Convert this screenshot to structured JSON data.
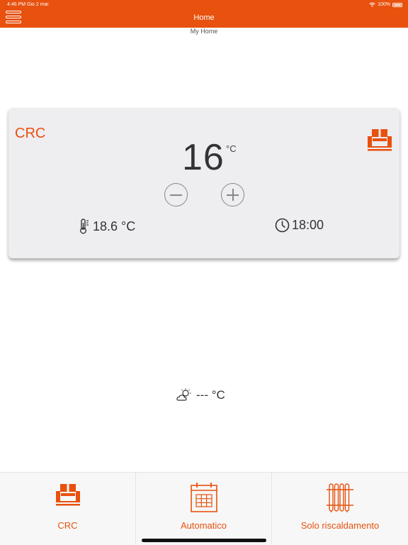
{
  "status_bar": {
    "time": "4:46 PM  Gio 2 mar",
    "battery": "100%"
  },
  "header": {
    "title": "Home",
    "subtitle": "My Home"
  },
  "zone_card": {
    "name": "CRC",
    "setpoint": "16",
    "setpoint_unit": "°C",
    "room_temperature": "18.6 °C",
    "timer": "18:00",
    "mode_icon": "sofa-icon"
  },
  "weather": {
    "icon": "partly-cloudy-icon",
    "value": "--- °C"
  },
  "bottom_tabs": [
    {
      "label": "CRC",
      "icon": "sofa-icon"
    },
    {
      "label": "Automatico",
      "icon": "calendar-icon"
    },
    {
      "label": "Solo riscaldamento",
      "icon": "radiator-icon"
    }
  ],
  "colors": {
    "accent": "#e8510e",
    "card_background": "#eeedf0",
    "text": "#333333"
  }
}
